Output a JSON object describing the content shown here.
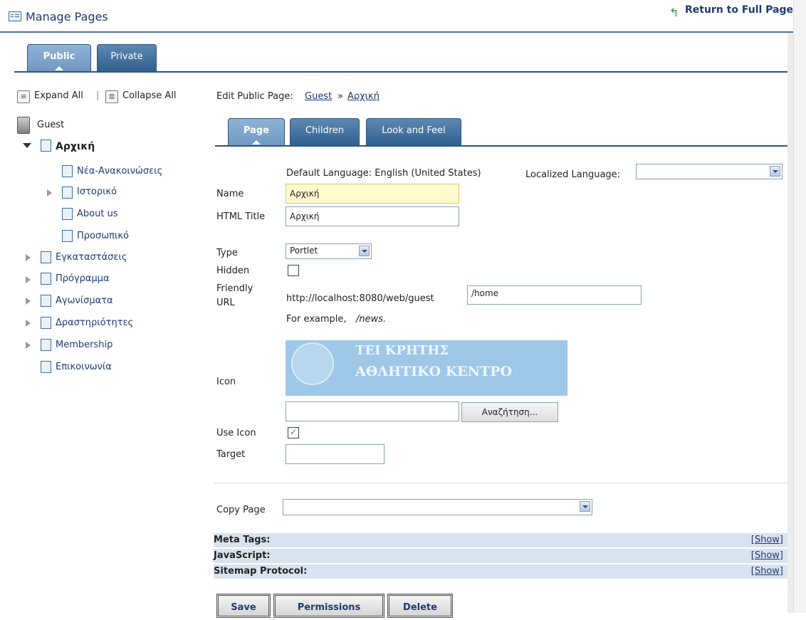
{
  "header": {
    "title": "Manage Pages",
    "return_label": "Return to Full Page"
  },
  "main_tabs": [
    {
      "label": "Public"
    },
    {
      "label": "Private"
    }
  ],
  "tree_controls": {
    "expand": "Expand All",
    "separator": "|",
    "collapse": "Collapse All"
  },
  "tree": {
    "root": "Guest",
    "items": [
      {
        "label": "Αρχική"
      },
      {
        "label": "Νέα-Ανακοινώσεις"
      },
      {
        "label": "Ιστορικό"
      },
      {
        "label": "About us"
      },
      {
        "label": "Προσωπικό"
      },
      {
        "label": "Εγκαταστάσεις"
      },
      {
        "label": "Πρόγραμμα"
      },
      {
        "label": "Αγωνίσματα"
      },
      {
        "label": "Δραστηριότητες"
      },
      {
        "label": "Membership"
      },
      {
        "label": "Επικοινωνία"
      }
    ]
  },
  "breadcrumb": {
    "prefix": "Edit Public Page:",
    "parent": "Guest",
    "sep": "»",
    "current": "Αρχική"
  },
  "edit_tabs": [
    {
      "label": "Page"
    },
    {
      "label": "Children"
    },
    {
      "label": "Look and Feel"
    }
  ],
  "form": {
    "default_language": "Default Language: English (United States)",
    "localized_language_label": "Localized Language:",
    "localized_language_value": "",
    "name_label": "Name",
    "name_value": "Αρχική",
    "html_title_label": "HTML Title",
    "html_title_value": "Αρχική",
    "type_label": "Type",
    "type_value": "Portlet",
    "hidden_label": "Hidden",
    "hidden_checked": false,
    "friendly_label_1": "Friendly",
    "friendly_label_2": "URL",
    "friendly_prefix": "http://localhost:8080/web/guest",
    "friendly_value": "/home",
    "example_prefix": "For example,",
    "example_value": "/news.",
    "icon_label": "Icon",
    "icon_image_line1": "ΤΕΙ ΚΡΗΤΗΣ",
    "icon_image_line2": "ΑΘΛΗΤΙΚΟ ΚΕΝΤΡΟ",
    "icon_file_value": "",
    "browse_label": "Αναζήτηση...",
    "use_icon_label": "Use Icon",
    "use_icon_checked": true,
    "target_label": "Target",
    "target_value": "",
    "copy_page_label": "Copy Page",
    "copy_page_value": ""
  },
  "meta_sections": [
    {
      "label": "Meta Tags:",
      "action": "[Show]"
    },
    {
      "label": "JavaScript:",
      "action": "[Show]"
    },
    {
      "label": "Sitemap Protocol:",
      "action": "[Show]"
    }
  ],
  "buttons": {
    "save": "Save",
    "permissions": "Permissions",
    "delete": "Delete"
  },
  "colors": {
    "tab_active": "#7fa6cc",
    "tab_inactive": "#3c6a98",
    "link": "#1f3a73",
    "meta_bg": "#d9e3ef",
    "name_bg": "#fffbd1"
  }
}
